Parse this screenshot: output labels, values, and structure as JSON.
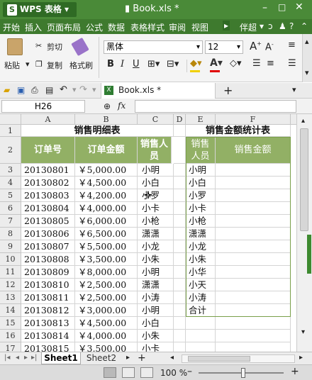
{
  "app": {
    "name": "WPS 表格",
    "doc_title": "Book.xls *",
    "tab_doc": "Book.xls *"
  },
  "menu": [
    "开始",
    "插入",
    "页面布局",
    "公式",
    "数据",
    "表格样式",
    "审阅",
    "视图"
  ],
  "menu_right": "伴超",
  "ribbon": {
    "paste": "粘贴",
    "cut": "剪切",
    "copy": "复制",
    "format_painter": "格式刷",
    "font": "黑体",
    "size": "12",
    "bold": "B",
    "italic": "I",
    "underline": "U"
  },
  "formula": {
    "cell_ref": "H26",
    "fx": "fx",
    "value": ""
  },
  "columns": [
    "A",
    "B",
    "C",
    "D",
    "E",
    "F"
  ],
  "left_table": {
    "title": "销售明细表",
    "headers": [
      "订单号",
      "订单金额",
      "销售人员"
    ],
    "rows": [
      [
        "20130801",
        "￥5,000.00",
        "小明"
      ],
      [
        "20130802",
        "￥4,500.00",
        "小白"
      ],
      [
        "20130803",
        "￥4,200.00",
        "小罗"
      ],
      [
        "20130804",
        "￥4,000.00",
        "小卡"
      ],
      [
        "20130805",
        "￥6,000.00",
        "小枪"
      ],
      [
        "20130806",
        "￥6,500.00",
        "潇潇"
      ],
      [
        "20130807",
        "￥5,500.00",
        "小龙"
      ],
      [
        "20130808",
        "￥3,500.00",
        "小朱"
      ],
      [
        "20130809",
        "￥8,000.00",
        "小明"
      ],
      [
        "20130810",
        "￥2,500.00",
        "潇潇"
      ],
      [
        "20130811",
        "￥2,500.00",
        "小涛"
      ],
      [
        "20130812",
        "￥3,000.00",
        "小明"
      ],
      [
        "20130813",
        "￥4,500.00",
        "小白"
      ],
      [
        "20130814",
        "￥4,000.00",
        "小朱"
      ],
      [
        "20130815",
        "￥3,500.00",
        "小卡"
      ]
    ]
  },
  "right_table": {
    "title": "销售金额统计表",
    "headers": [
      "销售人员",
      "销售金额"
    ],
    "names": [
      "小明",
      "小白",
      "小罗",
      "小卡",
      "小枪",
      "潇潇",
      "小龙",
      "小朱",
      "小华",
      "小天",
      "小涛",
      "合计"
    ]
  },
  "row_numbers": [
    "1",
    "2",
    "3",
    "4",
    "5",
    "6",
    "7",
    "8",
    "9",
    "10",
    "11",
    "12",
    "13",
    "14",
    "15",
    "16",
    "17"
  ],
  "sheets": [
    "Sheet1",
    "Sheet2"
  ],
  "status": {
    "zoom": "100 %"
  },
  "colors": {
    "header_green": "#92b065",
    "title_green": "#4a8a38"
  }
}
